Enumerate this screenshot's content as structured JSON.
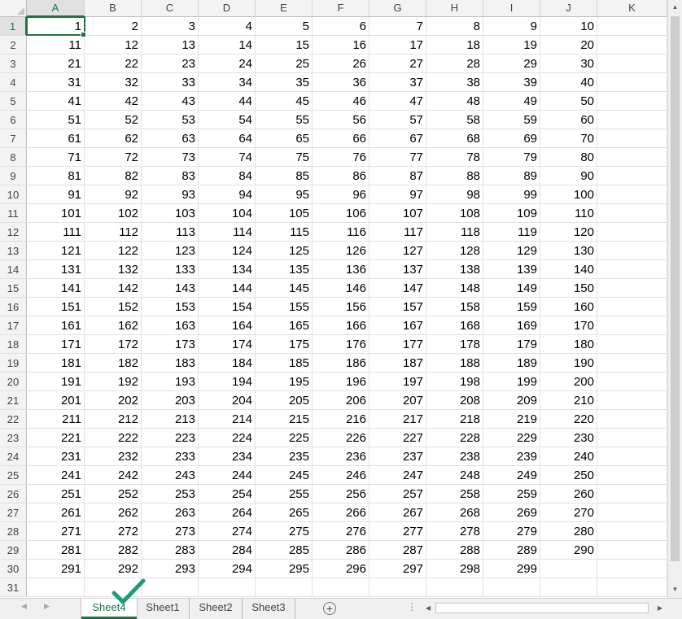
{
  "columns": [
    "A",
    "B",
    "C",
    "D",
    "E",
    "F",
    "G",
    "H",
    "I",
    "J",
    "K"
  ],
  "active_column": "A",
  "rows": [
    {
      "num": "1",
      "cells": [
        "1",
        "2",
        "3",
        "4",
        "5",
        "6",
        "7",
        "8",
        "9",
        "10",
        ""
      ]
    },
    {
      "num": "2",
      "cells": [
        "11",
        "12",
        "13",
        "14",
        "15",
        "16",
        "17",
        "18",
        "19",
        "20",
        ""
      ]
    },
    {
      "num": "3",
      "cells": [
        "21",
        "22",
        "23",
        "24",
        "25",
        "26",
        "27",
        "28",
        "29",
        "30",
        ""
      ]
    },
    {
      "num": "4",
      "cells": [
        "31",
        "32",
        "33",
        "34",
        "35",
        "36",
        "37",
        "38",
        "39",
        "40",
        ""
      ]
    },
    {
      "num": "5",
      "cells": [
        "41",
        "42",
        "43",
        "44",
        "45",
        "46",
        "47",
        "48",
        "49",
        "50",
        ""
      ]
    },
    {
      "num": "6",
      "cells": [
        "51",
        "52",
        "53",
        "54",
        "55",
        "56",
        "57",
        "58",
        "59",
        "60",
        ""
      ]
    },
    {
      "num": "7",
      "cells": [
        "61",
        "62",
        "63",
        "64",
        "65",
        "66",
        "67",
        "68",
        "69",
        "70",
        ""
      ]
    },
    {
      "num": "8",
      "cells": [
        "71",
        "72",
        "73",
        "74",
        "75",
        "76",
        "77",
        "78",
        "79",
        "80",
        ""
      ]
    },
    {
      "num": "9",
      "cells": [
        "81",
        "82",
        "83",
        "84",
        "85",
        "86",
        "87",
        "88",
        "89",
        "90",
        ""
      ]
    },
    {
      "num": "10",
      "cells": [
        "91",
        "92",
        "93",
        "94",
        "95",
        "96",
        "97",
        "98",
        "99",
        "100",
        ""
      ]
    },
    {
      "num": "11",
      "cells": [
        "101",
        "102",
        "103",
        "104",
        "105",
        "106",
        "107",
        "108",
        "109",
        "110",
        ""
      ]
    },
    {
      "num": "12",
      "cells": [
        "111",
        "112",
        "113",
        "114",
        "115",
        "116",
        "117",
        "118",
        "119",
        "120",
        ""
      ]
    },
    {
      "num": "13",
      "cells": [
        "121",
        "122",
        "123",
        "124",
        "125",
        "126",
        "127",
        "128",
        "129",
        "130",
        ""
      ]
    },
    {
      "num": "14",
      "cells": [
        "131",
        "132",
        "133",
        "134",
        "135",
        "136",
        "137",
        "138",
        "139",
        "140",
        ""
      ]
    },
    {
      "num": "15",
      "cells": [
        "141",
        "142",
        "143",
        "144",
        "145",
        "146",
        "147",
        "148",
        "149",
        "150",
        ""
      ]
    },
    {
      "num": "16",
      "cells": [
        "151",
        "152",
        "153",
        "154",
        "155",
        "156",
        "157",
        "158",
        "159",
        "160",
        ""
      ]
    },
    {
      "num": "17",
      "cells": [
        "161",
        "162",
        "163",
        "164",
        "165",
        "166",
        "167",
        "168",
        "169",
        "170",
        ""
      ]
    },
    {
      "num": "18",
      "cells": [
        "171",
        "172",
        "173",
        "174",
        "175",
        "176",
        "177",
        "178",
        "179",
        "180",
        ""
      ]
    },
    {
      "num": "19",
      "cells": [
        "181",
        "182",
        "183",
        "184",
        "185",
        "186",
        "187",
        "188",
        "189",
        "190",
        ""
      ]
    },
    {
      "num": "20",
      "cells": [
        "191",
        "192",
        "193",
        "194",
        "195",
        "196",
        "197",
        "198",
        "199",
        "200",
        ""
      ]
    },
    {
      "num": "21",
      "cells": [
        "201",
        "202",
        "203",
        "204",
        "205",
        "206",
        "207",
        "208",
        "209",
        "210",
        ""
      ]
    },
    {
      "num": "22",
      "cells": [
        "211",
        "212",
        "213",
        "214",
        "215",
        "216",
        "217",
        "218",
        "219",
        "220",
        ""
      ]
    },
    {
      "num": "23",
      "cells": [
        "221",
        "222",
        "223",
        "224",
        "225",
        "226",
        "227",
        "228",
        "229",
        "230",
        ""
      ]
    },
    {
      "num": "24",
      "cells": [
        "231",
        "232",
        "233",
        "234",
        "235",
        "236",
        "237",
        "238",
        "239",
        "240",
        ""
      ]
    },
    {
      "num": "25",
      "cells": [
        "241",
        "242",
        "243",
        "244",
        "245",
        "246",
        "247",
        "248",
        "249",
        "250",
        ""
      ]
    },
    {
      "num": "26",
      "cells": [
        "251",
        "252",
        "253",
        "254",
        "255",
        "256",
        "257",
        "258",
        "259",
        "260",
        ""
      ]
    },
    {
      "num": "27",
      "cells": [
        "261",
        "262",
        "263",
        "264",
        "265",
        "266",
        "267",
        "268",
        "269",
        "270",
        ""
      ]
    },
    {
      "num": "28",
      "cells": [
        "271",
        "272",
        "273",
        "274",
        "275",
        "276",
        "277",
        "278",
        "279",
        "280",
        ""
      ]
    },
    {
      "num": "29",
      "cells": [
        "281",
        "282",
        "283",
        "284",
        "285",
        "286",
        "287",
        "288",
        "289",
        "290",
        ""
      ]
    },
    {
      "num": "30",
      "cells": [
        "291",
        "292",
        "293",
        "294",
        "295",
        "296",
        "297",
        "298",
        "299",
        "",
        ""
      ]
    },
    {
      "num": "31",
      "cells": [
        "",
        "",
        "",
        "",
        "",
        "",
        "",
        "",
        "",
        "",
        ""
      ]
    }
  ],
  "selected_cell": "A1",
  "sheet_tabs": [
    {
      "label": "Sheet4",
      "active": true
    },
    {
      "label": "Sheet1",
      "active": false
    },
    {
      "label": "Sheet2",
      "active": false
    },
    {
      "label": "Sheet3",
      "active": false
    }
  ],
  "icons": {
    "tab_nav_prev": "triangle-left-icon",
    "tab_nav_next": "triangle-right-icon",
    "add_sheet": "plus-circle-icon",
    "options": "vertical-dots-icon",
    "check_overlay": "checkmark-icon"
  },
  "colors": {
    "accent": "#217346",
    "check_overlay": "#1b9e73",
    "header_bg": "#f3f3f3",
    "gridline": "#e1e1e1"
  }
}
